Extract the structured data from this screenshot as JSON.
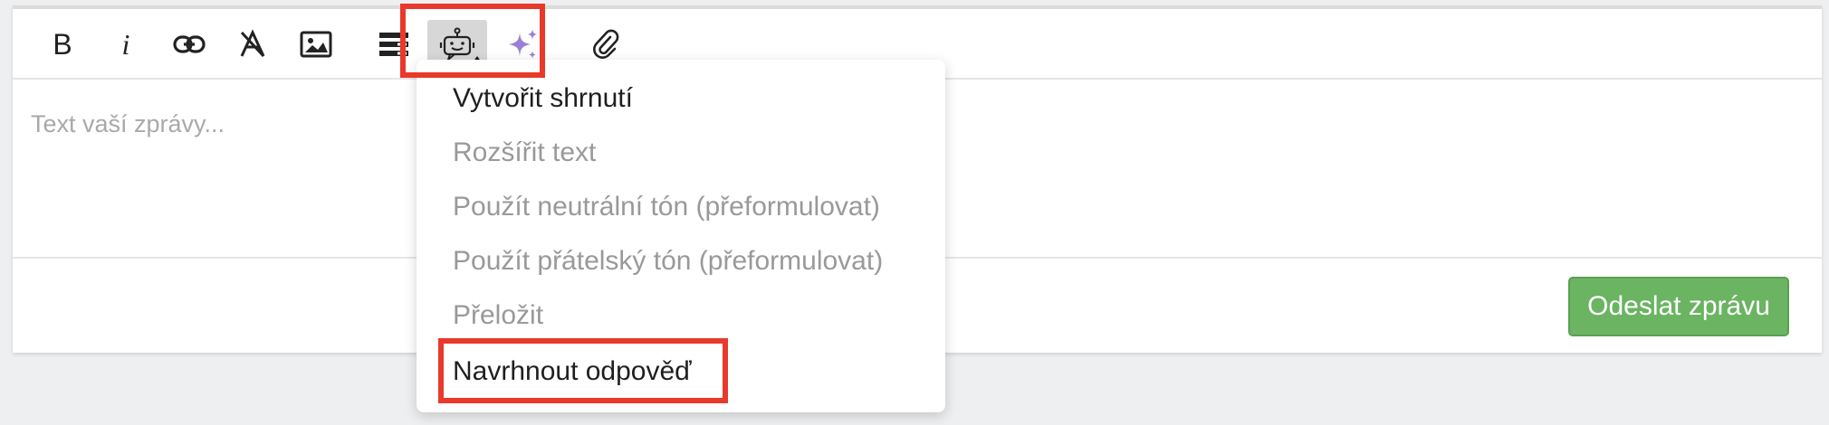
{
  "editor": {
    "placeholder": "Text vaší zprávy...",
    "toolbar": {
      "bold_label": "B",
      "italic_label": "i",
      "icons": [
        "link-icon",
        "clear-format-icon",
        "image-icon",
        "template-icon",
        "ai-assistant-icon",
        "sparkle-icon",
        "paperclip-icon"
      ]
    },
    "send_label": "Odeslat zprávu"
  },
  "ai_menu": {
    "items": [
      {
        "label": "Vytvořit shrnutí",
        "enabled": true
      },
      {
        "label": "Rozšířit text",
        "enabled": false
      },
      {
        "label": "Použít neutrální tón (přeformulovat)",
        "enabled": false
      },
      {
        "label": "Použít přátelský tón (přeformulovat)",
        "enabled": false
      },
      {
        "label": "Přeložit",
        "enabled": false
      },
      {
        "label": "Navrhnout odpověď",
        "enabled": true
      }
    ]
  },
  "colors": {
    "send_button": "#6ab462",
    "highlight": "#e8392b",
    "sparkle": "#9b7fd4"
  }
}
